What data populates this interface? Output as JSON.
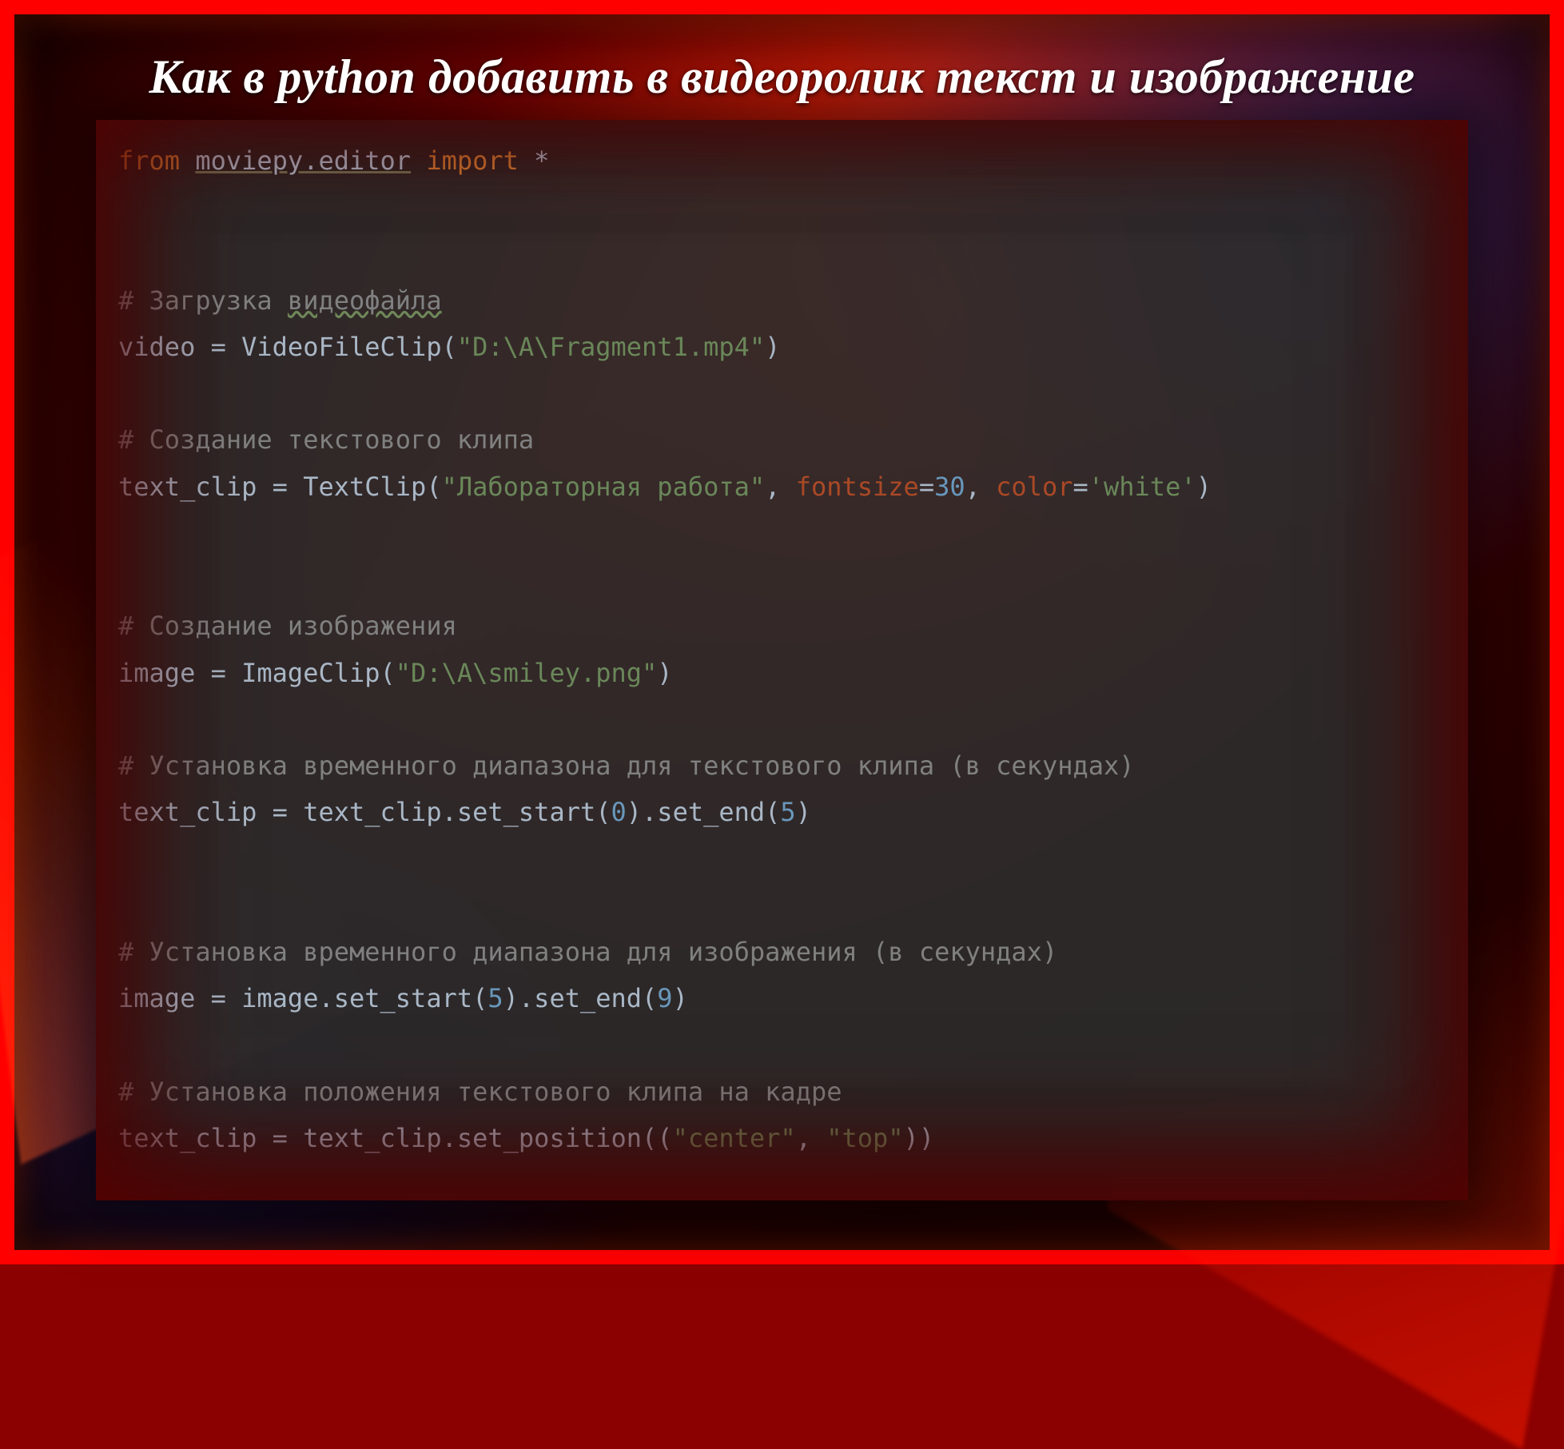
{
  "title": "Как в python добавить в видеоролик текст и изображение",
  "code": {
    "l1": {
      "kw1": "from",
      "pkg": "moviepy.editor",
      "kw2": "import",
      "star": "*"
    },
    "c1a": "# Загрузка ",
    "c1b": "видеофайла",
    "l2": {
      "var": "video",
      "eq": " = ",
      "call": "VideoFileClip(",
      "arg": "\"D:\\A\\Fragment1.mp4\"",
      "end": ")"
    },
    "c2": "# Создание текстового клипа",
    "l3": {
      "var": "text_clip",
      "eq": " = ",
      "call": "TextClip(",
      "arg1": "\"Лабораторная работа\"",
      "sep1": ", ",
      "k1": "fontsize",
      "eqn1": "=",
      "n1": "30",
      "sep2": ", ",
      "k2": "color",
      "eqn2": "=",
      "s2": "'white'",
      "end": ")"
    },
    "c3": "# Создание изображения",
    "l4": {
      "var": "image",
      "eq": " = ",
      "call": "ImageClip(",
      "arg": "\"D:\\A\\smiley.png\"",
      "end": ")"
    },
    "c4": "# Установка временного диапазона для текстового клипа (в секундах)",
    "l5": {
      "var": "text_clip",
      "eq": " = ",
      "expr1": "text_clip.set_start(",
      "n1": "0",
      "mid": ").set_end(",
      "n2": "5",
      "end": ")"
    },
    "c5": "# Установка временного диапазона для изображения (в секундах)",
    "l6": {
      "var": "image",
      "eq": " = ",
      "expr1": "image.set_start(",
      "n1": "5",
      "mid": ").set_end(",
      "n2": "9",
      "end": ")"
    },
    "c6": "# Установка положения текстового клипа на кадре",
    "l7": {
      "var": "text_clip",
      "eq": " = ",
      "expr1": "text_clip.set_position((",
      "s1": "\"center\"",
      "sep": ", ",
      "s2": "\"top\"",
      "end": "))"
    }
  }
}
